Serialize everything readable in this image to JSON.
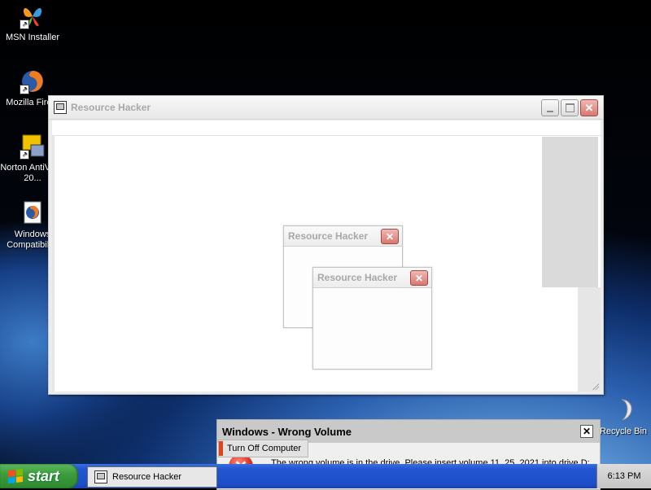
{
  "desktop": {
    "icons": [
      {
        "label": "MSN Installer",
        "icon": "msn-butterfly-icon"
      },
      {
        "label": "Mozilla Fire...",
        "icon": "firefox-icon"
      },
      {
        "label": "Norton AntiVirus 20...",
        "icon": "norton-antivirus-icon"
      },
      {
        "label": "Windows Compatibili...",
        "icon": "windows-compat-icon"
      },
      {
        "label": "Recycle Bin",
        "icon": "recycle-bin-icon"
      }
    ]
  },
  "main_window": {
    "title": "Resource Hacker"
  },
  "dialog_1": {
    "title": "Resource Hacker"
  },
  "dialog_2": {
    "title": "Resource Hacker"
  },
  "error_dialog": {
    "title": "Windows - Wrong Volume",
    "close_glyph": "✕",
    "message": "The wrong volume is in the drive. Please insert volume 11_25_2021 into drive D:."
  },
  "tooltip": {
    "label": "Turn Off Computer"
  },
  "taskbar": {
    "start_label": "start",
    "task_button": "Resource Hacker",
    "clock": "6:13 PM"
  },
  "colors": {
    "taskbar": "#2356d3",
    "start": "#3b9a3b",
    "close": "#d77870"
  }
}
